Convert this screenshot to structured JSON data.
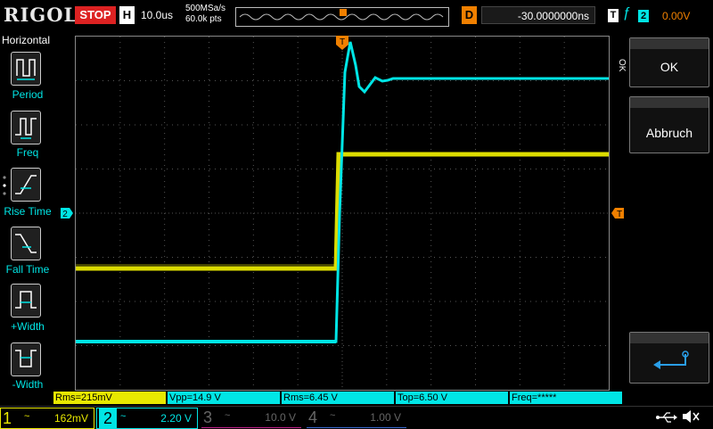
{
  "brand": "RIGOL",
  "run_state": "STOP",
  "horizontal": {
    "badge": "H",
    "scale": "10.0us",
    "sample_rate": "500MSa/s",
    "mem_depth": "60.0k pts"
  },
  "delay": {
    "badge": "D",
    "value": "-30.0000000ns"
  },
  "trigger": {
    "badge": "T",
    "edge_symbol": "ƒ",
    "source": "2",
    "level": "0.00V",
    "marker": "T"
  },
  "left_menu": {
    "title": "Horizontal",
    "items": [
      {
        "label": "Period"
      },
      {
        "label": "Freq"
      },
      {
        "label": "Rise Time"
      },
      {
        "label": "Fall Time"
      },
      {
        "label": "+Width"
      },
      {
        "label": "-Width"
      }
    ]
  },
  "right_panel": {
    "ok_side_label": "OK",
    "ok_label": "OK",
    "cancel_label": "Abbruch",
    "enter_icon": "enter-icon"
  },
  "measurements": [
    {
      "text": "Rms=215mV",
      "color": "#e8e800"
    },
    {
      "text": "Vpp=14.9 V",
      "color": "#00e5e5"
    },
    {
      "text": "Rms=6.45 V",
      "color": "#00e5e5"
    },
    {
      "text": "Top=6.50 V",
      "color": "#00e5e5"
    },
    {
      "text": "Freq=*****",
      "color": "#00e5e5"
    }
  ],
  "channels": [
    {
      "num": "1",
      "coupling": "~",
      "scale": "162mV",
      "color": "#e8e800",
      "active": true
    },
    {
      "num": "2",
      "coupling": "~",
      "scale": "2.20 V",
      "color": "#00e5e5",
      "active": true
    },
    {
      "num": "3",
      "coupling": "~",
      "scale": "10.0 V",
      "color": "#c0208a",
      "active": false
    },
    {
      "num": "4",
      "coupling": "~",
      "scale": "1.00 V",
      "color": "#3a6ad0",
      "active": false
    }
  ],
  "ch2_marker": "2",
  "status_icons": [
    "usb-icon",
    "sound-muted-icon"
  ],
  "colors": {
    "ch1": "#e8e800",
    "ch2": "#00e5e5",
    "trigger": "#f08000",
    "stop": "#dd2222"
  }
}
